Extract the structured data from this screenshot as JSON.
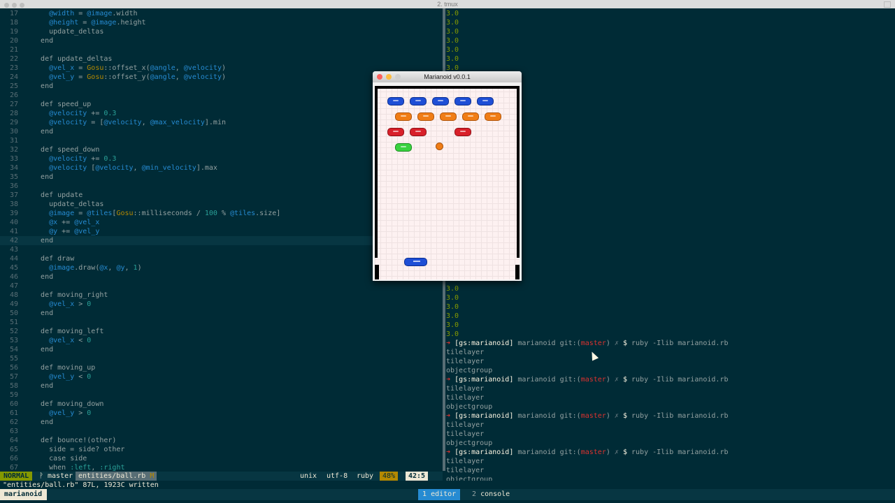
{
  "window_title": "2. tmux",
  "editor": {
    "lines": [
      {
        "n": "17",
        "t": "    @width = @image.width"
      },
      {
        "n": "18",
        "t": "    @height = @image.height"
      },
      {
        "n": "19",
        "t": "    update_deltas"
      },
      {
        "n": "20",
        "t": "  end"
      },
      {
        "n": "21",
        "t": ""
      },
      {
        "n": "22",
        "t": "  def update_deltas"
      },
      {
        "n": "23",
        "t": "    @vel_x = Gosu::offset_x(@angle, @velocity)"
      },
      {
        "n": "24",
        "t": "    @vel_y = Gosu::offset_y(@angle, @velocity)"
      },
      {
        "n": "25",
        "t": "  end"
      },
      {
        "n": "26",
        "t": ""
      },
      {
        "n": "27",
        "t": "  def speed_up"
      },
      {
        "n": "28",
        "t": "    @velocity += 0.3"
      },
      {
        "n": "29",
        "t": "    @velocity = [@velocity, @max_velocity].min"
      },
      {
        "n": "30",
        "t": "  end"
      },
      {
        "n": "31",
        "t": ""
      },
      {
        "n": "32",
        "t": "  def speed_down"
      },
      {
        "n": "33",
        "t": "    @velocity += 0.3"
      },
      {
        "n": "34",
        "t": "    @velocity [@velocity, @min_velocity].max"
      },
      {
        "n": "35",
        "t": "  end"
      },
      {
        "n": "36",
        "t": ""
      },
      {
        "n": "37",
        "t": "  def update"
      },
      {
        "n": "38",
        "t": "    update_deltas"
      },
      {
        "n": "39",
        "t": "    @image = @tiles[Gosu::milliseconds / 100 % @tiles.size]"
      },
      {
        "n": "40",
        "t": "    @x += @vel_x"
      },
      {
        "n": "41",
        "t": "    @y += @vel_y"
      },
      {
        "n": "42",
        "t": "  end"
      },
      {
        "n": "43",
        "t": ""
      },
      {
        "n": "44",
        "t": "  def draw"
      },
      {
        "n": "45",
        "t": "    @image.draw(@x, @y, 1)"
      },
      {
        "n": "46",
        "t": "  end"
      },
      {
        "n": "47",
        "t": ""
      },
      {
        "n": "48",
        "t": "  def moving_right"
      },
      {
        "n": "49",
        "t": "    @vel_x > 0"
      },
      {
        "n": "50",
        "t": "  end"
      },
      {
        "n": "51",
        "t": ""
      },
      {
        "n": "52",
        "t": "  def moving_left"
      },
      {
        "n": "53",
        "t": "    @vel_x < 0"
      },
      {
        "n": "54",
        "t": "  end"
      },
      {
        "n": "55",
        "t": ""
      },
      {
        "n": "56",
        "t": "  def moving_up"
      },
      {
        "n": "57",
        "t": "    @vel_y < 0"
      },
      {
        "n": "58",
        "t": "  end"
      },
      {
        "n": "59",
        "t": ""
      },
      {
        "n": "60",
        "t": "  def moving_down"
      },
      {
        "n": "61",
        "t": "    @vel_y > 0"
      },
      {
        "n": "62",
        "t": "  end"
      },
      {
        "n": "63",
        "t": ""
      },
      {
        "n": "64",
        "t": "  def bounce!(other)"
      },
      {
        "n": "65",
        "t": "    side = side? other"
      },
      {
        "n": "66",
        "t": "    case side"
      },
      {
        "n": "67",
        "t": "    when :left, :right"
      }
    ],
    "cursor_line": "42"
  },
  "statusline": {
    "mode": "NORMAL",
    "branch": "ᚹ master",
    "file": "entities/ball.rb",
    "modified": "M",
    "fileformat": "unix",
    "encoding": "utf-8",
    "filetype": "ruby",
    "percent": "48%",
    "position": "42:5"
  },
  "message": "\"entities/ball.rb\" 87L, 1923C written",
  "console": {
    "top_values": [
      "3.0",
      "3.0",
      "3.0",
      "3.0",
      "3.0",
      "3.0",
      "3.0"
    ],
    "mid_values": [
      "3.0",
      "3.0",
      "3.0",
      "3.0",
      "3.0",
      "3.0"
    ],
    "prompt": {
      "arrow": "➜",
      "user": "[gs:marianoid]",
      "dir": "marianoid git:(",
      "branch": "master",
      "close": ")",
      "x": "✗",
      "dollar": "$",
      "command": "ruby -Ilib marianoid.rb"
    },
    "output": [
      "tilelayer",
      "tilelayer",
      "objectgroup"
    ]
  },
  "tmux": {
    "session": "marianoid",
    "win1_index": "1",
    "win1_name": "editor",
    "win2_index": "2",
    "win2_name": "console"
  },
  "game": {
    "title": "Marianoid v0.0.1"
  },
  "colors": {
    "background": "#002b36",
    "brick_blue": "#1e4fd6",
    "brick_orange": "#f07d16",
    "brick_red": "#d8202a",
    "brick_green": "#39d23f"
  }
}
